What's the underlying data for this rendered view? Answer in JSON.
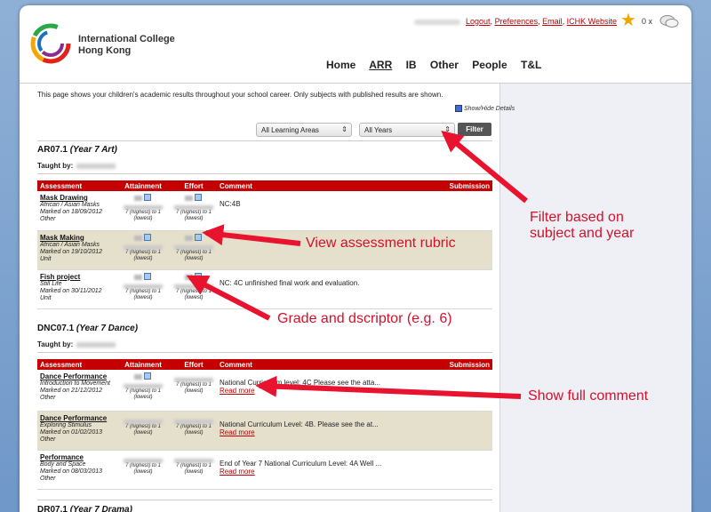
{
  "school": {
    "name_line1": "International College",
    "name_line2": "Hong Kong"
  },
  "toplinks": {
    "logout": "Logout",
    "preferences": "Preferences",
    "email": "Email",
    "website": "ICHK Website",
    "star_count": "0 x"
  },
  "nav": [
    "Home",
    "ARR",
    "IB",
    "Other",
    "People",
    "T&L"
  ],
  "intro": "This page shows your children's academic results throughout your school career. Only subjects with published results are shown.",
  "show_hide": "Show/Hide Details",
  "filters": {
    "area": "All Learning Areas",
    "year": "All Years",
    "button": "Filter"
  },
  "headers": {
    "assessment": "Assessment",
    "attainment": "Attainment",
    "effort": "Effort",
    "comment": "Comment",
    "submission": "Submission"
  },
  "taught_label": "Taught by:",
  "scale_text": "7 (highest) to 1 (lowest)",
  "read_more": "Read more",
  "sections": [
    {
      "code": "AR07.1",
      "name": "(Year 7 Art)",
      "rows": [
        {
          "title": "Mask Drawing",
          "topic": "African / Asian Masks",
          "marked": "Marked on 18/09/2012",
          "type": "Other",
          "comment": "NC:4B",
          "read_more": false
        },
        {
          "title": "Mask Making",
          "topic": "African / Asian Masks",
          "marked": "Marked on 19/10/2012",
          "type": "Unit",
          "comment": "",
          "read_more": false
        },
        {
          "title": "Fish project",
          "topic": "Still Life",
          "marked": "Marked on 30/11/2012",
          "type": "Unit",
          "comment": "NC: 4C unfinished final work and evaluation.",
          "read_more": false
        }
      ]
    },
    {
      "code": "DNC07.1",
      "name": "(Year 7 Dance)",
      "rows": [
        {
          "title": "Dance Performance",
          "topic": "Introduction to Movement",
          "marked": "Marked on 21/12/2012",
          "type": "Other",
          "comment": "National Curriculum level: 4C Please see the atta...",
          "read_more": true
        },
        {
          "title": "Dance Performance",
          "topic": "Exploring Stimulus",
          "marked": "Marked on 01/02/2013",
          "type": "Other",
          "comment": "National Curriculum Level: 4B. Please see the at...",
          "read_more": true
        },
        {
          "title": "Performance",
          "topic": "Body and Space",
          "marked": "Marked on 08/03/2013",
          "type": "Other",
          "comment": "End of Year 7 National Curriculum Level: 4A Well ...",
          "read_more": true
        }
      ]
    },
    {
      "code": "DR07.1",
      "name": "(Year 7 Drama)",
      "rows": []
    }
  ],
  "callouts": {
    "filter_line1": "Filter based on",
    "filter_line2": "subject and year",
    "rubric": "View assessment rubric",
    "grade": "Grade and dscriptor (e.g. 6)",
    "comment": "Show full comment"
  },
  "colors": {
    "accent_red": "#c40000",
    "callout_red": "#d6102a",
    "row_alt": "#e5e0cc",
    "background_blue": "#7ea3d0"
  }
}
